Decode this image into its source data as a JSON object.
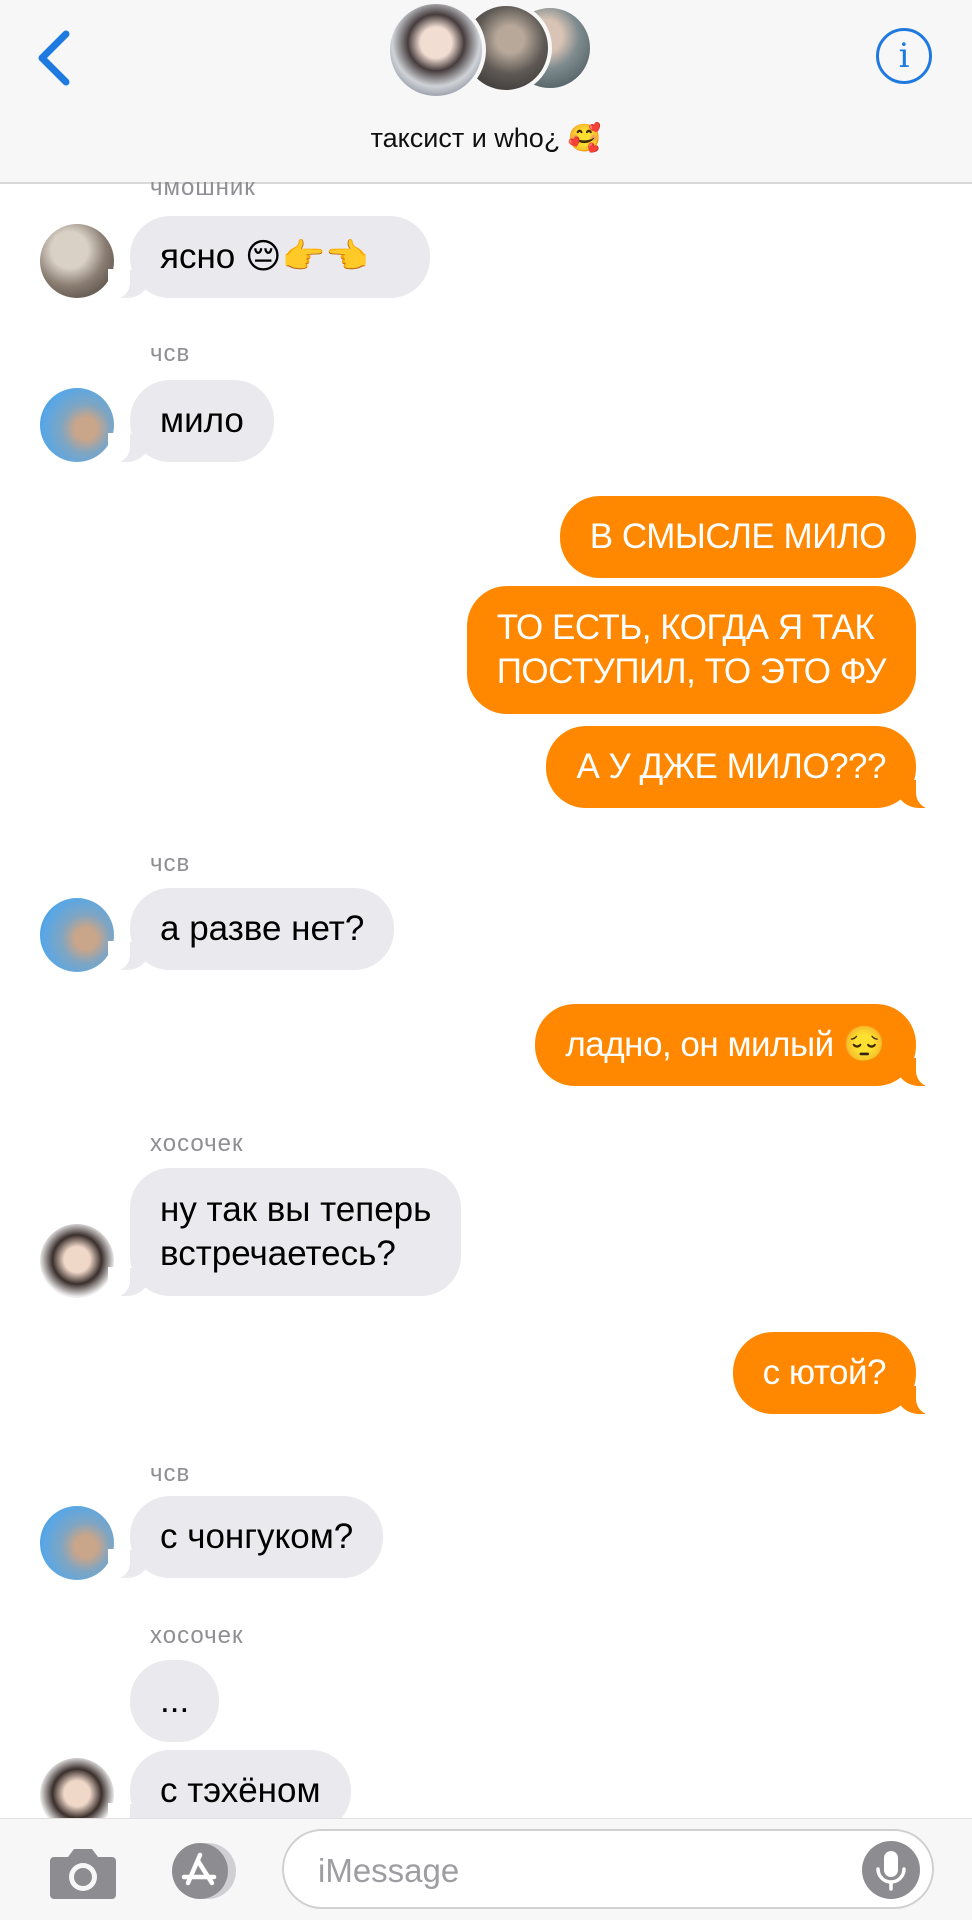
{
  "header": {
    "title": "таксист и who¿ 🥰",
    "info_glyph": "i",
    "colors": {
      "accent": "#1f7ae0"
    }
  },
  "messages": [
    {
      "sender": "чмошник",
      "text": "ясно 😔👉👈",
      "direction": "incoming"
    },
    {
      "sender": "чсв",
      "text": "мило",
      "direction": "incoming"
    },
    {
      "text": "В СМЫСЛЕ МИЛО",
      "direction": "outgoing"
    },
    {
      "text_lines": [
        "ТО ЕСТЬ, КОГДА Я ТАК",
        "ПОСТУПИЛ, ТО ЭТО ФУ"
      ],
      "direction": "outgoing"
    },
    {
      "text": "А У ДЖЕ МИЛО???",
      "direction": "outgoing"
    },
    {
      "sender": "чсв",
      "text": "а разве нет?",
      "direction": "incoming"
    },
    {
      "text": "ладно, он милый 😔",
      "direction": "outgoing"
    },
    {
      "sender": "хосочек",
      "text_lines": [
        "ну так вы теперь",
        "встречаетесь?"
      ],
      "direction": "incoming"
    },
    {
      "text": "с ютой?",
      "direction": "outgoing"
    },
    {
      "sender": "чсв",
      "text": "с чонгуком?",
      "direction": "incoming"
    },
    {
      "sender": "хосочек",
      "text": "...",
      "direction": "incoming"
    },
    {
      "text": "с тэхёном",
      "direction": "incoming"
    }
  ],
  "composer": {
    "placeholder": "iMessage"
  },
  "colors": {
    "outgoing_bubble": "#ff8800",
    "incoming_bubble": "#e9e9ee",
    "sender_label": "#8e8e93"
  }
}
